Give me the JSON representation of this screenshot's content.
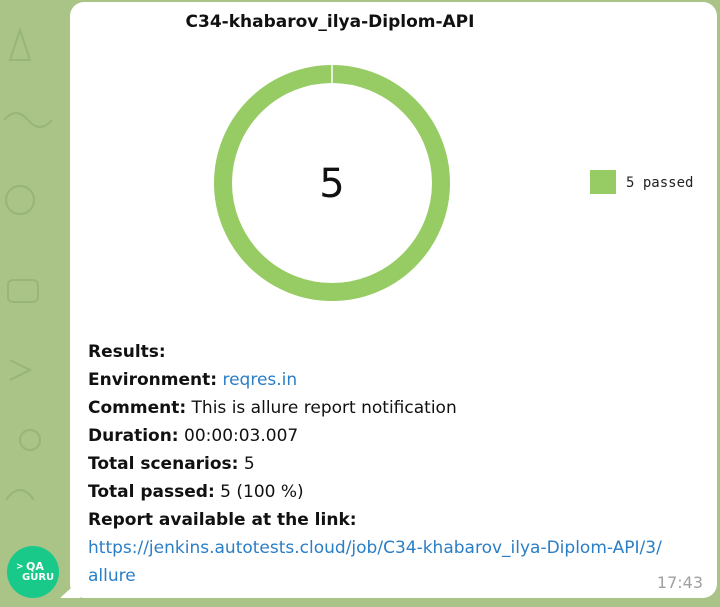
{
  "avatar": {
    "line1": "QA",
    "line2": "GURU",
    "arrow": ">"
  },
  "chart_data": {
    "type": "pie",
    "title": "C34-khabarov_ilya-Diplom-API",
    "center_label": "5",
    "slices": [
      {
        "name": "5 passed",
        "value": 5
      }
    ],
    "colors": [
      "#97cc64"
    ],
    "legend_position": "right"
  },
  "message": {
    "results_label": "Results:",
    "environment_label": "Environment:",
    "environment_value": "reqres.in",
    "comment_label": "Comment:",
    "comment_value": "This is allure report notification",
    "duration_label": "Duration:",
    "duration_value": "00:00:03.007",
    "total_scenarios_label": "Total scenarios:",
    "total_scenarios_value": "5",
    "total_passed_label": "Total passed:",
    "total_passed_value": "5 (100 %)",
    "report_label": "Report available at the link:",
    "report_url": "https://jenkins.autotests.cloud/job/C34-khabarov_ilya-Diplom-API/3/allure"
  },
  "timestamp": "17:43"
}
